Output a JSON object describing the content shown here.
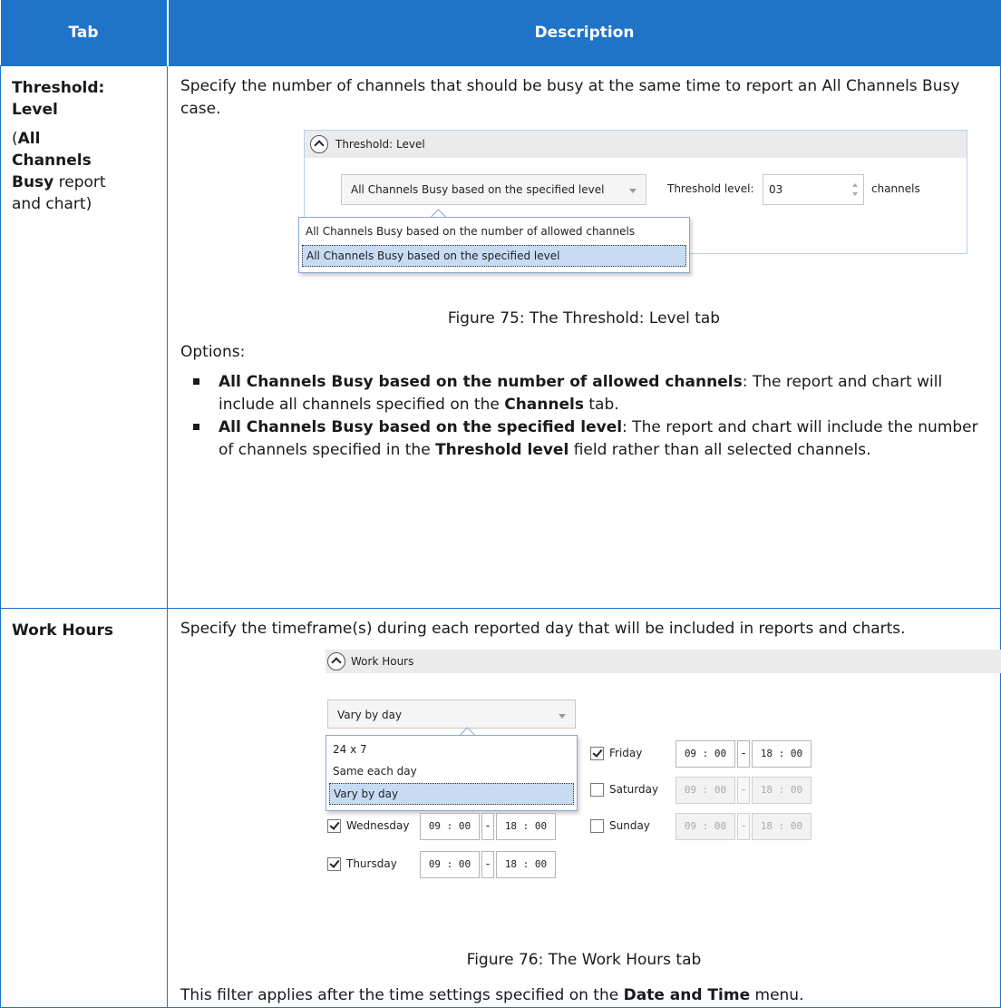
{
  "header": {
    "col_tab": "Tab",
    "col_description": "Description"
  },
  "row1": {
    "tab_line1": "Threshold:",
    "tab_line2": "Level",
    "tab_paren_open": "(",
    "tab_bold1": "All",
    "tab_bold2": "Channels",
    "tab_bold3": "Busy",
    "tab_rest1": " report",
    "tab_rest2": "and chart)",
    "intro": "Specify the number of channels that should be busy at the same time to report an All Channels Busy case.",
    "shot": {
      "section_title": "Threshold: Level",
      "combo_value": "All Channels Busy based on the specified level",
      "threshold_label": "Threshold level:",
      "threshold_value": "03",
      "channels_label": "channels",
      "options": [
        "All Channels Busy based on the number of allowed channels",
        "All Channels Busy based on the specified level"
      ],
      "selected_index": 1
    },
    "caption": "Figure 75: The Threshold: Level tab",
    "options_label": "Options:",
    "bullet1_bold": "All Channels Busy based on the number of allowed channels",
    "bullet1_text_a": ": The report and chart will include all channels specified on the ",
    "bullet1_bold2": "Channels",
    "bullet1_text_b": " tab.",
    "bullet2_bold": "All Channels Busy based on the specified level",
    "bullet2_text_a": ": The report and chart will include the number of channels specified in the ",
    "bullet2_bold2": "Threshold level",
    "bullet2_text_b": " field rather than all selected channels."
  },
  "row2": {
    "tab": "Work Hours",
    "intro": "Specify the timeframe(s) during each reported day that will be included in reports and charts.",
    "shot": {
      "section_title": "Work Hours",
      "combo_value": "Vary by day",
      "options": [
        "24 x 7",
        "Same each day",
        "Vary by day"
      ],
      "selected_index": 2,
      "days": {
        "friday": {
          "name": "Friday",
          "checked": true,
          "start": "09 : 00",
          "end": "18 : 00",
          "sep": "-"
        },
        "saturday": {
          "name": "Saturday",
          "checked": false,
          "start": "09 : 00",
          "end": "18 : 00",
          "sep": "-"
        },
        "sunday": {
          "name": "Sunday",
          "checked": false,
          "start": "09 : 00",
          "end": "18 : 00",
          "sep": "-"
        },
        "wednesday": {
          "name": "Wednesday",
          "checked": true,
          "start": "09 : 00",
          "end": "18 : 00",
          "sep": "-"
        },
        "thursday": {
          "name": "Thursday",
          "checked": true,
          "start": "09 : 00",
          "end": "18 : 00",
          "sep": "-"
        }
      }
    },
    "caption": "Figure 76: The Work Hours tab",
    "footer_text_a": "This filter applies after the time settings specified on the ",
    "footer_bold": "Date and Time",
    "footer_text_b": " menu."
  }
}
